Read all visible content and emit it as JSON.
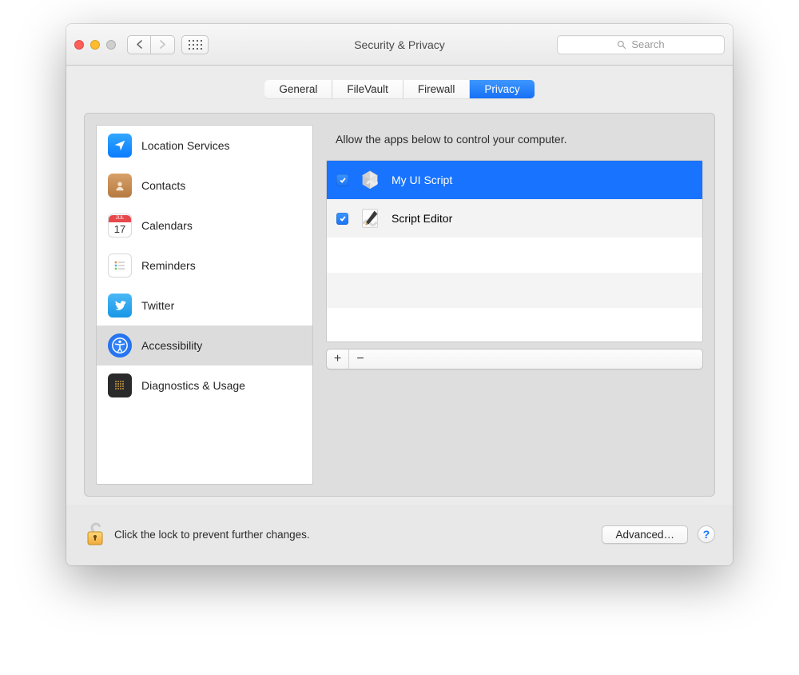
{
  "window": {
    "title": "Security & Privacy"
  },
  "search": {
    "placeholder": "Search"
  },
  "tabs": [
    {
      "label": "General"
    },
    {
      "label": "FileVault"
    },
    {
      "label": "Firewall"
    },
    {
      "label": "Privacy"
    }
  ],
  "sidebar": {
    "items": [
      {
        "label": "Location Services"
      },
      {
        "label": "Contacts"
      },
      {
        "label": "Calendars"
      },
      {
        "label": "Reminders"
      },
      {
        "label": "Twitter"
      },
      {
        "label": "Accessibility"
      },
      {
        "label": "Diagnostics & Usage"
      }
    ]
  },
  "right": {
    "heading": "Allow the apps below to control your computer.",
    "apps": [
      {
        "name": "My UI Script",
        "checked": true,
        "selected": true
      },
      {
        "name": "Script Editor",
        "checked": true,
        "selected": false
      }
    ]
  },
  "footer": {
    "lock_text": "Click the lock to prevent further changes.",
    "advanced": "Advanced…",
    "help": "?"
  },
  "calendar_day": "17",
  "calendar_month": "JUL"
}
